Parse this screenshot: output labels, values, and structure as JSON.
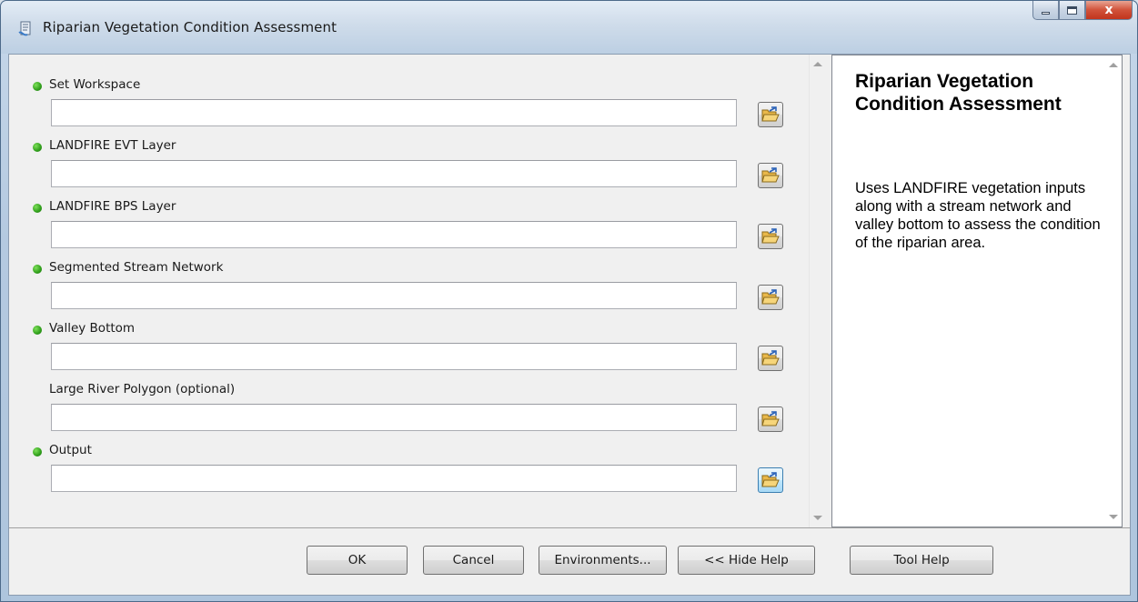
{
  "window": {
    "title": "Riparian Vegetation Condition Assessment",
    "close_label": "x"
  },
  "parameters": [
    {
      "label": "Set Workspace",
      "required": true,
      "value": ""
    },
    {
      "label": "LANDFIRE EVT Layer",
      "required": true,
      "value": ""
    },
    {
      "label": "LANDFIRE BPS Layer",
      "required": true,
      "value": ""
    },
    {
      "label": "Segmented Stream Network",
      "required": true,
      "value": ""
    },
    {
      "label": "Valley Bottom",
      "required": true,
      "value": ""
    },
    {
      "label": "Large River Polygon (optional)",
      "required": false,
      "value": ""
    },
    {
      "label": "Output",
      "required": true,
      "value": ""
    }
  ],
  "help": {
    "title": "Riparian Vegetation Condition Assessment",
    "body": "Uses LANDFIRE vegetation inputs along with a stream network and valley bottom to assess the condition of the riparian area."
  },
  "buttons": {
    "ok": "OK",
    "cancel": "Cancel",
    "environments": "Environments...",
    "hide_help": "<< Hide Help",
    "tool_help": "Tool Help"
  },
  "colors": {
    "required_dot": "#2f9e1a",
    "focus_border": "#3c7fb1"
  },
  "icons": {
    "title": "toolbox-script-icon",
    "browse": "open-folder-icon"
  }
}
